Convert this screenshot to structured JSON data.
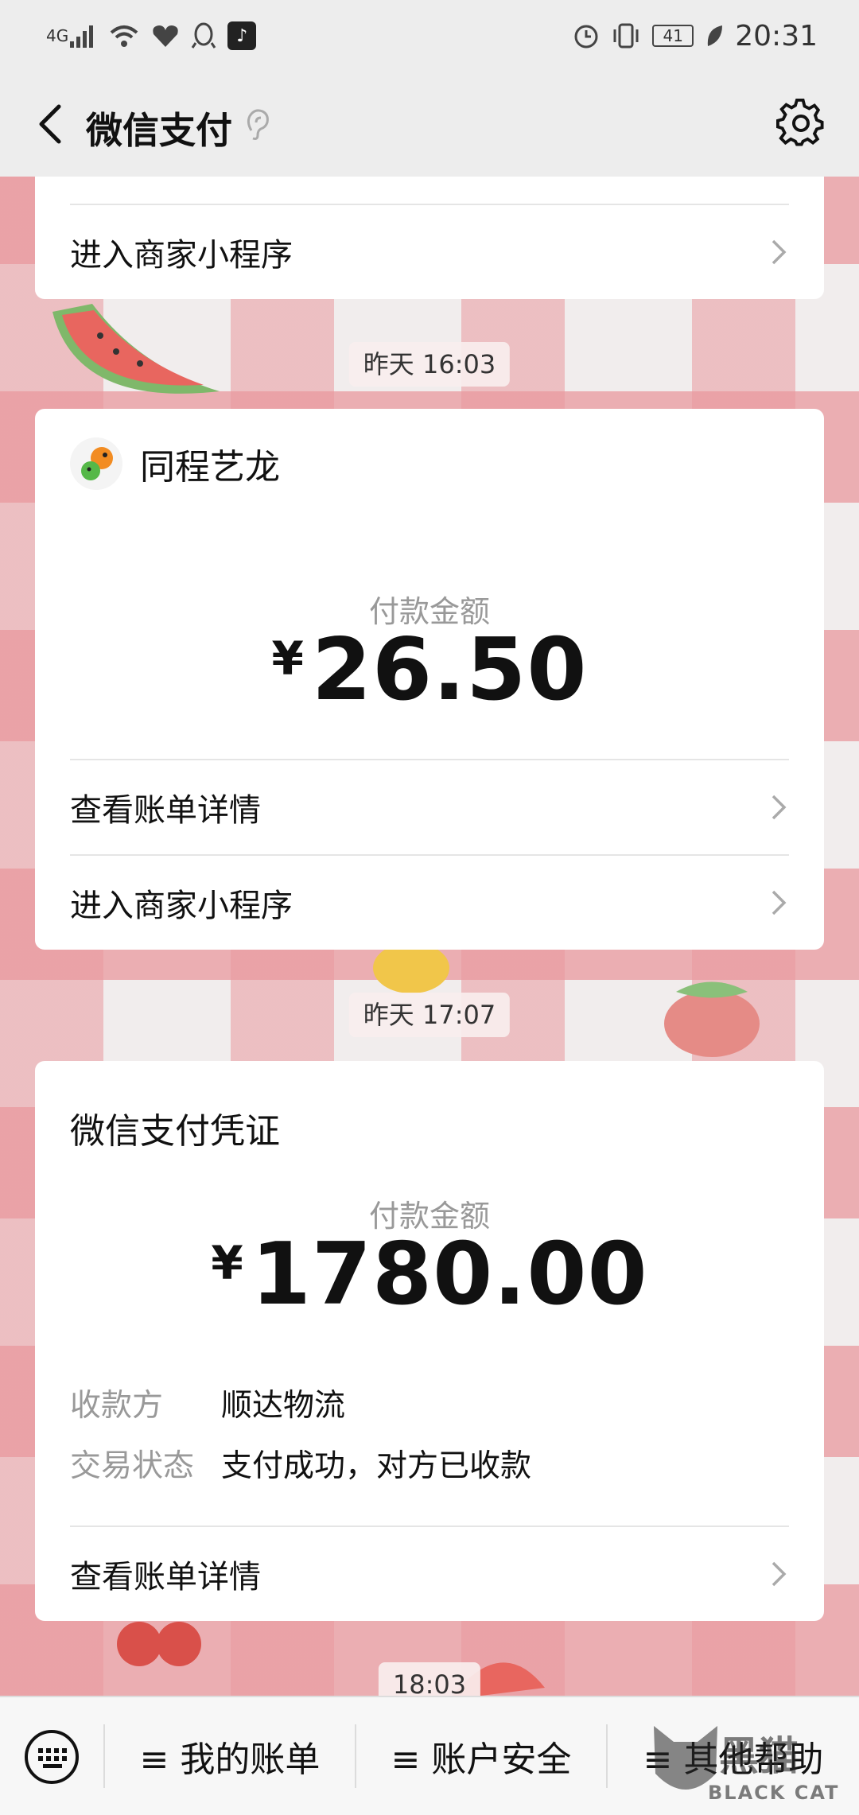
{
  "status_bar": {
    "network": "4G",
    "battery": "41",
    "time": "20:31",
    "icons": [
      "signal-icon",
      "wifi-icon",
      "health-icon",
      "qq-icon",
      "tiktok-icon",
      "alarm-icon",
      "vibrate-icon",
      "battery-icon",
      "leaf-icon"
    ]
  },
  "header": {
    "title": "微信支付"
  },
  "card0": {
    "mini_program_label": "进入商家小程序"
  },
  "timestamps": [
    "昨天 16:03",
    "昨天 17:07",
    "18:03"
  ],
  "card1": {
    "merchant": "同程艺龙",
    "amount_label": "付款金额",
    "currency": "¥",
    "amount": "26.50",
    "details_label": "查看账单详情",
    "mini_program_label": "进入商家小程序"
  },
  "card2": {
    "title": "微信支付凭证",
    "amount_label": "付款金额",
    "currency": "¥",
    "amount": "1780.00",
    "payee_key": "收款方",
    "payee_value": "顺达物流",
    "status_key": "交易状态",
    "status_value": "支付成功，对方已收款",
    "details_label": "查看账单详情"
  },
  "bottom_menu": {
    "items": [
      "≡ 我的账单",
      "≡ 账户安全",
      "≡ 其他帮助"
    ]
  },
  "watermark": {
    "text": "黑猫",
    "subtext": "BLACK CAT"
  },
  "colors": {
    "bar_bg": "#ededed",
    "wallpaper_pink": "#e9999e",
    "text_gray": "#999999"
  }
}
